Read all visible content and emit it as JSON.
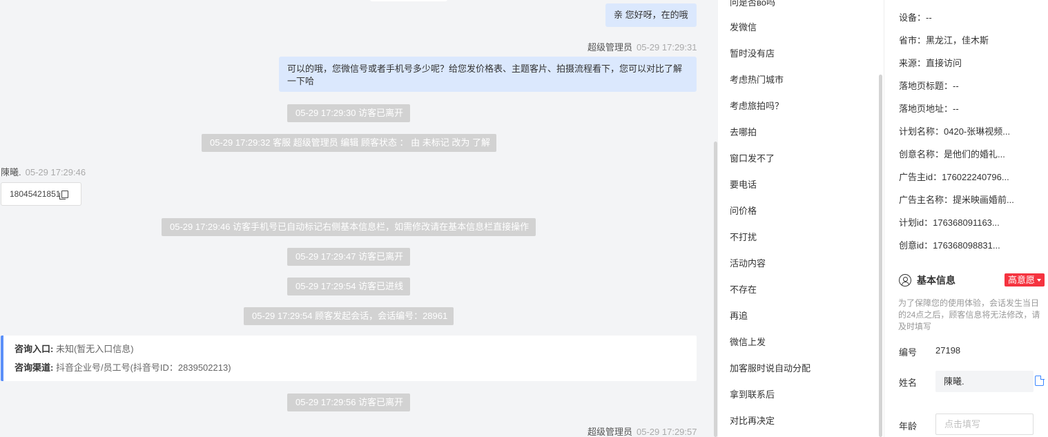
{
  "chat": {
    "msg1": {
      "text": "亲 您好呀，在的哦"
    },
    "msg2": {
      "sender": "超级管理员",
      "time": "05-29 17:29:31",
      "text_line1": "可以的哦，您微信号或者手机号多少呢？给您发价格表、主题客片、拍摄流程看下，您可以对比了解",
      "text_line2": "一下哈"
    },
    "sys1": "05-29 17:29:30 访客已离开",
    "sys2": "05-29 17:29:32 客服 超级管理员 编辑 顾客状态 ： 由 未标记 改为 了解",
    "visitor_msg": {
      "sender": "陳曦.",
      "time": "05-29 17:29:46",
      "phone": "18045421851"
    },
    "sys3": "05-29 17:29:46 访客手机号已自动标记右侧基本信息栏，如需修改请在基本信息栏直接操作",
    "sys4": "05-29 17:29:47 访客已离开",
    "sys5": "05-29 17:29:54 访客已进线",
    "sys6": "05-29 17:29:54 顾客发起会话，会话编号：28961",
    "entry_card": {
      "entry_label": "咨询入口:",
      "entry_value": "未知(暂无入口信息)",
      "channel_label": "咨询渠道:",
      "channel_value": "抖音企业号/员工号(抖音号ID：2839502213)"
    },
    "sys7": "05-29 17:29:56 访客已离开",
    "last_meta": {
      "sender": "超级管理员",
      "time": "05-29 17:29:57"
    }
  },
  "quick_replies": {
    "partial_top": "问是否во吗",
    "items": [
      "发微信",
      "暂时没有店",
      "考虑热门城市",
      "考虑旅拍吗？",
      "去哪拍",
      "窗口发不了",
      "要电话",
      "问价格",
      "不打扰",
      "活动内容",
      "不存在",
      "再追",
      "微信上发",
      "加客服时说自动分配",
      "拿到联系后",
      "对比再决定"
    ]
  },
  "visitor_info": {
    "device": "设备：--",
    "province": "省市：黑龙江，佳木斯",
    "source": "来源：直接访问",
    "landing_title": "落地页标题：--",
    "landing_url": "落地页地址：--",
    "plan_name": "计划名称：0420-张琳视频...",
    "creative_name": "创意名称：是他们的婚礼...",
    "advertiser_id": "广告主id：176022240796...",
    "advertiser_name": "广告主名称：提米映画婚前...",
    "plan_id": "计划id：176368091163...",
    "creative_id": "创意id：176368098831..."
  },
  "basic_info": {
    "title": "基本信息",
    "intent_tag": "高意愿",
    "notice": "为了保障您的使用体验，会话发生当日的24点之后，顾客信息将无法修改，请及时填写",
    "number_label": "编号",
    "number_value": "27198",
    "name_label": "姓名",
    "name_value": "陳曦.",
    "age_label": "年龄",
    "age_placeholder": "点击填写"
  },
  "colors": {
    "accent_blue": "#5b8ff9",
    "bubble_blue": "#dbe8fd",
    "intent_red": "#f5333f"
  }
}
